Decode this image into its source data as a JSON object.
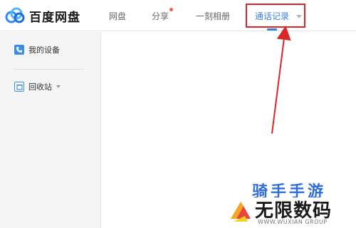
{
  "header": {
    "brand": "百度网盘",
    "nav": [
      {
        "label": "网盘"
      },
      {
        "label": "分享"
      },
      {
        "label": "一刻相册"
      },
      {
        "label": "通话记录"
      }
    ]
  },
  "sidebar": {
    "items": [
      {
        "label": "我的设备",
        "icon": "phone-icon"
      },
      {
        "label": "回收站",
        "icon": "recycle-bin-icon"
      }
    ]
  },
  "watermark": {
    "top": "骑手手游",
    "main": "无限数码",
    "sub": "WWW.WUXIAN GROUP"
  },
  "colors": {
    "accent": "#3a7fd8",
    "annotation": "#d9262b",
    "badge": "#f25c54"
  }
}
